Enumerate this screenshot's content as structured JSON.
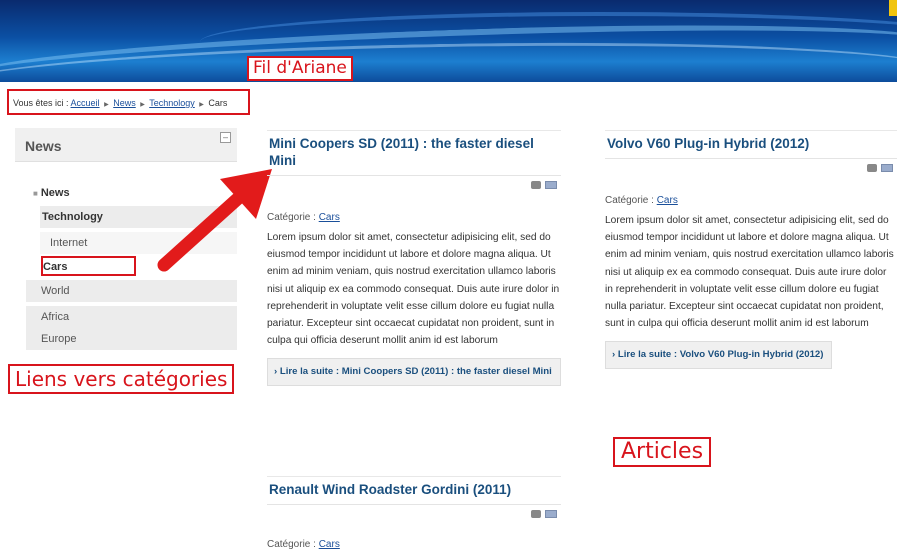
{
  "banner": {
    "accent_color": "#0b4fa3"
  },
  "annotations": {
    "fil_ariane": "Fil d'Ariane",
    "liens": "Liens vers catégories",
    "articles": "Articles",
    "color": "#d8141c"
  },
  "breadcrumb": {
    "prefix": "Vous êtes ici :",
    "items": [
      "Accueil",
      "News",
      "Technology"
    ],
    "current": "Cars",
    "separator": "▶"
  },
  "sidebar": {
    "title": "News",
    "toggle": "–",
    "root": "News",
    "items": [
      "Technology",
      "Internet",
      "Cars",
      "World",
      "Africa",
      "Europe"
    ]
  },
  "articles": [
    {
      "title": "Mini Coopers SD (2011) : the faster diesel Mini",
      "category_label": "Catégorie :",
      "category": "Cars",
      "text": "Lorem ipsum dolor sit amet, consectetur adipisicing elit, sed do eiusmod tempor incididunt ut labore et dolore magna aliqua. Ut enim ad minim veniam, quis nostrud exercitation ullamco laboris nisi ut aliquip ex ea commodo consequat. Duis aute irure dolor in reprehenderit in voluptate velit esse cillum dolore eu fugiat nulla pariatur. Excepteur sint occaecat cupidatat non proident, sunt in culpa qui officia deserunt mollit anim id est laborum",
      "readmore": "› Lire la suite : Mini Coopers SD (2011) : the faster diesel Mini"
    },
    {
      "title": "Volvo V60 Plug-in Hybrid (2012)",
      "category_label": "Catégorie :",
      "category": "Cars",
      "text": "Lorem ipsum dolor sit amet, consectetur adipisicing elit, sed do eiusmod tempor incididunt ut labore et dolore magna aliqua. Ut enim ad minim veniam, quis nostrud exercitation ullamco laboris nisi ut aliquip ex ea commodo consequat. Duis aute irure dolor in reprehenderit in voluptate velit esse cillum dolore eu fugiat nulla pariatur. Excepteur sint occaecat cupidatat non proident, sunt in culpa qui officia deserunt mollit anim id est laborum",
      "readmore": "› Lire la suite : Volvo V60 Plug-in Hybrid (2012)"
    },
    {
      "title": "Renault Wind Roadster Gordini (2011)",
      "category_label": "Catégorie :",
      "category": "Cars"
    }
  ]
}
